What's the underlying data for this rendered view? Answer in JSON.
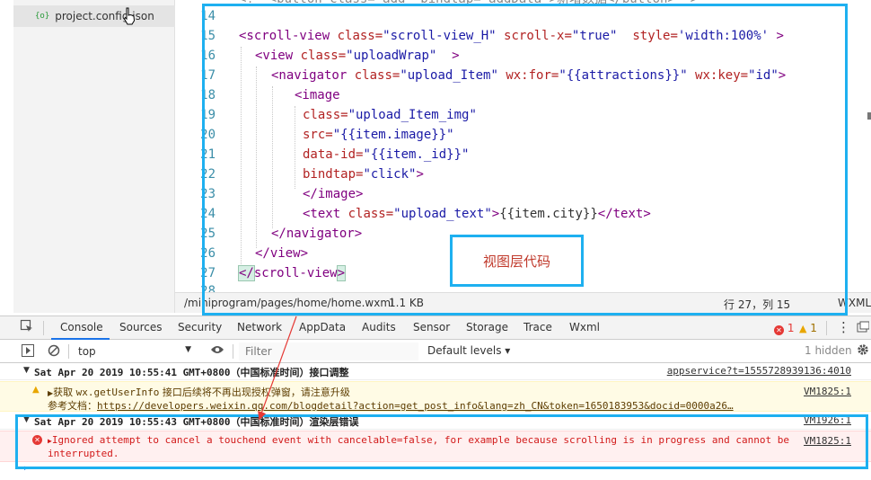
{
  "file_tree": {
    "item_icon": "{o}",
    "item_label": "project.config.json"
  },
  "editor": {
    "partial_top_line": "<!--<button class=\"add\" bindtap=\"addData\">新增数据</button>-->",
    "lines": [
      {
        "n": "14"
      },
      {
        "n": "15"
      },
      {
        "n": "16"
      },
      {
        "n": "17"
      },
      {
        "n": "18"
      },
      {
        "n": "19"
      },
      {
        "n": "20"
      },
      {
        "n": "21"
      },
      {
        "n": "22"
      },
      {
        "n": "23"
      },
      {
        "n": "24"
      },
      {
        "n": "25"
      },
      {
        "n": "26"
      },
      {
        "n": "27"
      },
      {
        "n": "28"
      }
    ],
    "code": {
      "l15": {
        "tag_open": "<scroll-view",
        "a1": " class=",
        "v1": "\"scroll-view_H\"",
        "a2": " scroll-x=",
        "v2": "\"true\"",
        "a3": "  style=",
        "v3": "'width:100%'",
        "end": " >"
      },
      "l16": {
        "tag_open": "<view",
        "a1": " class=",
        "v1": "\"uploadWrap\"",
        "end": "  >"
      },
      "l17": {
        "tag_open": "<navigator",
        "a1": " class=",
        "v1": "\"upload_Item\"",
        "a2": " wx:for=",
        "v2": "\"{{attractions}}\"",
        "a3": " wx:key=",
        "v3": "\"id\"",
        "end": ">"
      },
      "l18": {
        "tag_open": "<image"
      },
      "l19": {
        "a1": "class=",
        "v1": "\"upload_Item_img\""
      },
      "l20": {
        "a1": "src=",
        "v1": "\"{{item.image}}\""
      },
      "l21": {
        "a1": "data-id=",
        "v1": "\"{{item._id}}\""
      },
      "l22": {
        "a1": "bindtap=",
        "v1": "\"click\"",
        "end": ">"
      },
      "l23": {
        "tag_close": "</image>"
      },
      "l24": {
        "tag_open": "<text",
        "a1": " class=",
        "v1": "\"upload_text\"",
        "mid": ">",
        "text": "{{item.city}}",
        "tag_close": "</text>"
      },
      "l25": {
        "tag_close": "</navigator>"
      },
      "l26": {
        "tag_close": "</view>"
      },
      "l27": {
        "tag_a": "</",
        "tag_b": "scroll-view",
        "tag_c": ">"
      }
    }
  },
  "statusbar": {
    "path": "/miniprogram/pages/home/home.wxml",
    "size": "1.1 KB",
    "cursor": "行 27，列 15",
    "lang": "WXML"
  },
  "devtools": {
    "tabs": [
      "Console",
      "Sources",
      "Security",
      "Network",
      "AppData",
      "Audits",
      "Sensor",
      "Storage",
      "Trace",
      "Wxml"
    ],
    "active_tab": "Console",
    "error_count": "1",
    "warning_count": "1",
    "more_label": "⋮",
    "context_value": "top",
    "filter_placeholder": "Filter",
    "levels_label": "Default levels ▾",
    "hidden_label": "1 hidden"
  },
  "console": {
    "groups": [
      {
        "header": "Sat Apr 20 2019 10:55:41 GMT+0800（中国标准时间）接口调整",
        "source": "appservice?t=1555728939136:4010",
        "entries": [
          {
            "level": "warning",
            "line1_a": "获取 ",
            "line1_code": "wx.getUserInfo",
            "line1_b": " 接口后续将不再出现授权弹窗，请注意升级",
            "line2_label": "参考文档：",
            "line2_link": "https://developers.weixin.qq.com/blogdetail?action=get_post_info&lang=zh_CN&token=1650183953&docid=0000a26…",
            "source": "VM1825:1"
          }
        ]
      },
      {
        "header": "Sat Apr 20 2019 10:55:43 GMT+0800（中国标准时间）渲染层错误",
        "source": "VM1926:1",
        "entries": [
          {
            "level": "error",
            "text": "Ignored attempt to cancel a touchend event with cancelable=false, for example because scrolling is in progress and cannot be interrupted.",
            "source": "VM1825:1"
          }
        ]
      }
    ],
    "prompt": "›"
  },
  "annotation": {
    "callout_text": "视图层代码",
    "color": "#1eb0f0"
  }
}
